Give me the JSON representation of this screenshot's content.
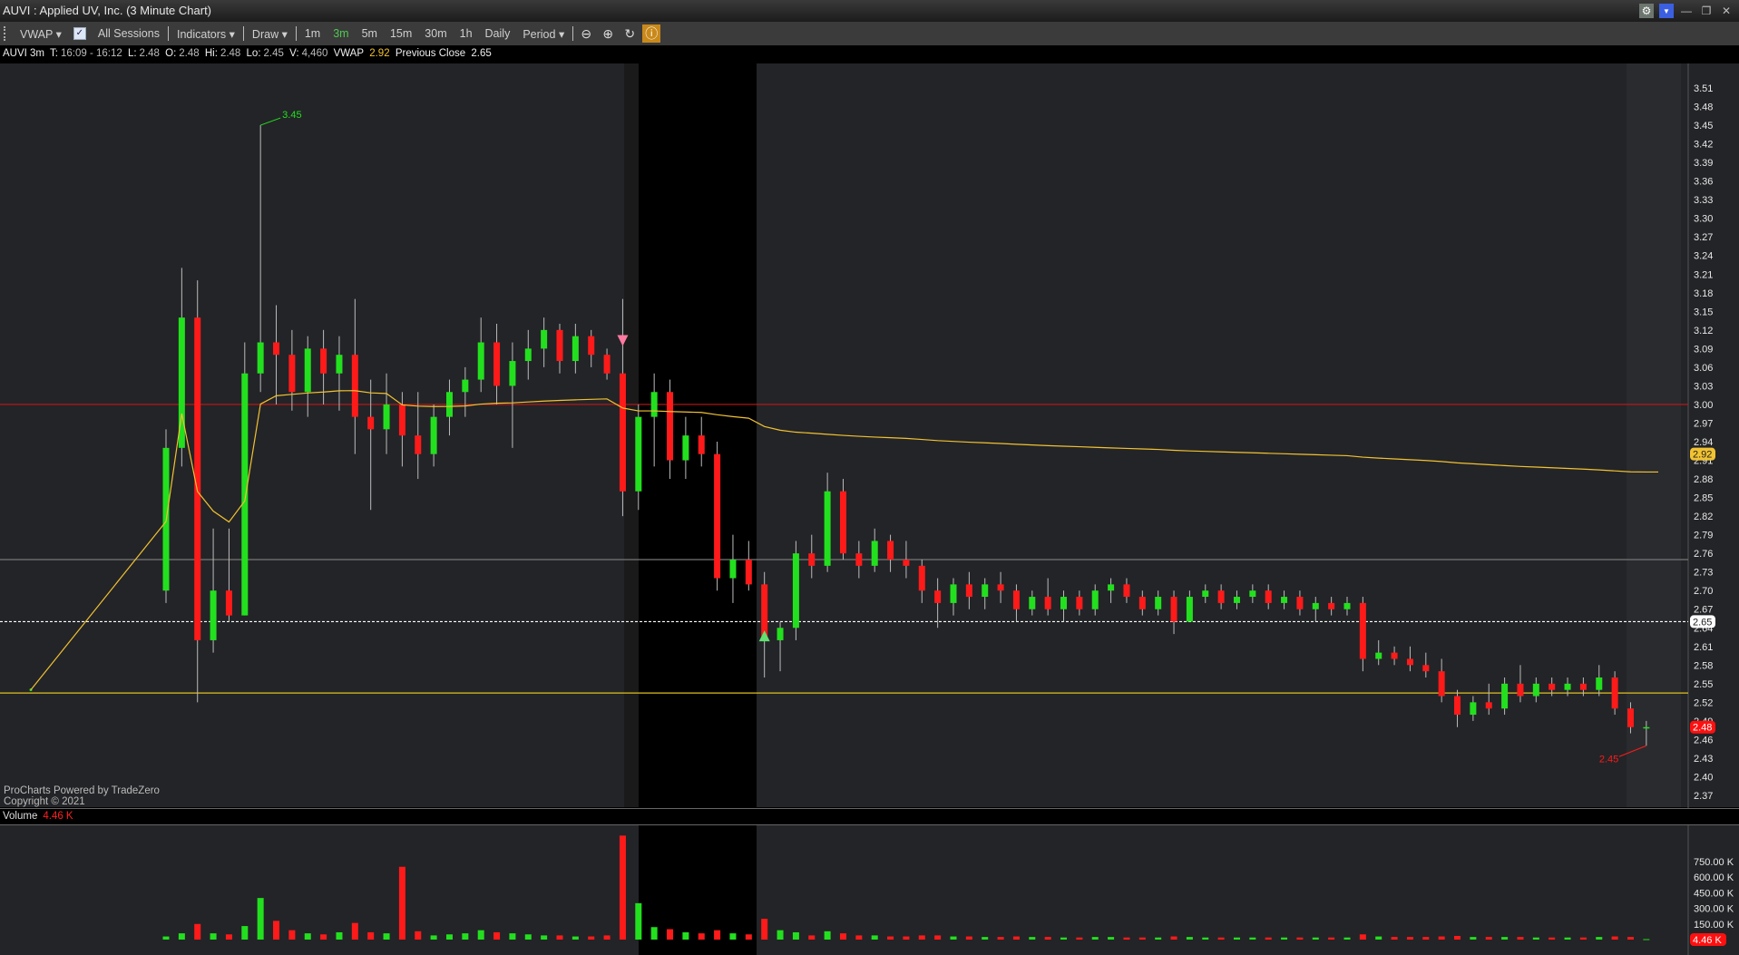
{
  "window": {
    "title": "AUVI : Applied UV, Inc. (3 Minute Chart)"
  },
  "toolbar": {
    "vwap": "VWAP",
    "all_sessions": "All Sessions",
    "indicators": "Indicators",
    "draw": "Draw",
    "intervals": [
      "1m",
      "3m",
      "5m",
      "15m",
      "30m",
      "1h",
      "Daily"
    ],
    "active_interval": "3m",
    "period": "Period"
  },
  "info": {
    "symbol": "AUVI 3m",
    "t_label": "T:",
    "t_value": "16:09 - 16:12",
    "l_label": "L:",
    "l_value": "2.48",
    "o_label": "O:",
    "o_value": "2.48",
    "hi_label": "Hi:",
    "hi_value": "2.48",
    "lo_label": "Lo:",
    "lo_value": "2.45",
    "v_label": "V:",
    "v_value": "4,460",
    "vwap_label": "VWAP",
    "vwap_value": "2.92",
    "prev_label": "Previous Close",
    "prev_value": "2.65"
  },
  "watermark": {
    "line1": "ProCharts Powered by TradeZero",
    "line2": "Copyright © 2021"
  },
  "volume_pane": {
    "label": "Volume",
    "value": "4.46 K"
  },
  "colors": {
    "up": "#22e01e",
    "down": "#ff1a1a",
    "vwap": "#f1c232",
    "bg": "#232427",
    "accent": "#c9891a"
  },
  "chart_data": {
    "type": "candlestick",
    "title": "AUVI : Applied UV, Inc. (3 Minute Chart)",
    "price_ticks": [
      "3.51",
      "3.48",
      "3.45",
      "3.42",
      "3.39",
      "3.36",
      "3.33",
      "3.30",
      "3.27",
      "3.24",
      "3.21",
      "3.18",
      "3.15",
      "3.12",
      "3.09",
      "3.06",
      "3.03",
      "3.00",
      "2.97",
      "2.94",
      "2.91",
      "2.88",
      "2.85",
      "2.82",
      "2.79",
      "2.76",
      "2.73",
      "2.70",
      "2.67",
      "2.64",
      "2.61",
      "2.58",
      "2.55",
      "2.52",
      "2.49",
      "2.46",
      "2.43",
      "2.40",
      "2.37"
    ],
    "ylim": [
      2.37,
      3.51
    ],
    "volume_ticks": [
      "750.00 K",
      "600.00 K",
      "450.00 K",
      "300.00 K",
      "150.00 K"
    ],
    "volume_max_k": 750,
    "premarket_price": 2.54,
    "levels": [
      {
        "price": 3.0,
        "color": "#c01818",
        "style": "solid"
      },
      {
        "price": 2.75,
        "color": "#777777",
        "style": "solid"
      },
      {
        "price": 2.65,
        "color": "#ffffff",
        "style": "dashed"
      },
      {
        "price": 2.535,
        "color": "#e0c020",
        "style": "solid"
      }
    ],
    "axis_badges": [
      {
        "text": "2.92",
        "price": 2.92,
        "bg": "#f1c232",
        "fg": "#222"
      },
      {
        "text": "2.65",
        "price": 2.65,
        "bg": "#ffffff",
        "fg": "#222"
      },
      {
        "text": "2.48",
        "price": 2.48,
        "bg": "#ff1010",
        "fg": "#fff"
      }
    ],
    "high_label": {
      "text": "3.45",
      "index": 6
    },
    "low_label": {
      "text": "2.45",
      "index": 94
    },
    "sell_marker_index": 29,
    "buy_marker_index": 38,
    "candles_ohlcv_k": [
      [
        2.7,
        2.96,
        2.68,
        2.93,
        30
      ],
      [
        2.93,
        3.22,
        2.9,
        3.14,
        60
      ],
      [
        3.14,
        3.2,
        2.52,
        2.62,
        150
      ],
      [
        2.62,
        2.8,
        2.6,
        2.7,
        60
      ],
      [
        2.7,
        2.8,
        2.65,
        2.66,
        50
      ],
      [
        2.66,
        3.1,
        2.66,
        3.05,
        130
      ],
      [
        3.05,
        3.45,
        3.02,
        3.1,
        400
      ],
      [
        3.1,
        3.16,
        3.0,
        3.08,
        180
      ],
      [
        3.08,
        3.12,
        2.99,
        3.02,
        90
      ],
      [
        3.02,
        3.11,
        2.98,
        3.09,
        60
      ],
      [
        3.09,
        3.12,
        3.0,
        3.05,
        50
      ],
      [
        3.05,
        3.11,
        2.99,
        3.08,
        70
      ],
      [
        3.08,
        3.17,
        2.92,
        2.98,
        160
      ],
      [
        2.98,
        3.04,
        2.83,
        2.96,
        70
      ],
      [
        2.96,
        3.05,
        2.92,
        3.0,
        60
      ],
      [
        3.0,
        3.02,
        2.9,
        2.95,
        700
      ],
      [
        2.95,
        3.02,
        2.88,
        2.92,
        80
      ],
      [
        2.92,
        3.0,
        2.9,
        2.98,
        40
      ],
      [
        2.98,
        3.04,
        2.95,
        3.02,
        50
      ],
      [
        3.02,
        3.06,
        2.98,
        3.04,
        60
      ],
      [
        3.04,
        3.14,
        3.02,
        3.1,
        90
      ],
      [
        3.1,
        3.13,
        3.0,
        3.03,
        70
      ],
      [
        3.03,
        3.1,
        2.93,
        3.07,
        60
      ],
      [
        3.07,
        3.12,
        3.04,
        3.09,
        50
      ],
      [
        3.09,
        3.14,
        3.06,
        3.12,
        40
      ],
      [
        3.12,
        3.13,
        3.05,
        3.07,
        40
      ],
      [
        3.07,
        3.13,
        3.05,
        3.11,
        30
      ],
      [
        3.11,
        3.12,
        3.06,
        3.08,
        30
      ],
      [
        3.08,
        3.09,
        3.04,
        3.05,
        40
      ],
      [
        3.05,
        3.17,
        2.82,
        2.86,
        1000
      ],
      [
        2.86,
        3.0,
        2.83,
        2.98,
        350
      ],
      [
        2.98,
        3.05,
        2.9,
        3.02,
        120
      ],
      [
        3.02,
        3.04,
        2.88,
        2.91,
        100
      ],
      [
        2.91,
        2.98,
        2.88,
        2.95,
        70
      ],
      [
        2.95,
        2.98,
        2.9,
        2.92,
        60
      ],
      [
        2.92,
        2.94,
        2.7,
        2.72,
        90
      ],
      [
        2.72,
        2.79,
        2.68,
        2.75,
        60
      ],
      [
        2.75,
        2.78,
        2.7,
        2.71,
        50
      ],
      [
        2.71,
        2.73,
        2.56,
        2.62,
        200
      ],
      [
        2.62,
        2.65,
        2.57,
        2.64,
        90
      ],
      [
        2.64,
        2.78,
        2.62,
        2.76,
        70
      ],
      [
        2.76,
        2.79,
        2.72,
        2.74,
        40
      ],
      [
        2.74,
        2.89,
        2.73,
        2.86,
        80
      ],
      [
        2.86,
        2.88,
        2.75,
        2.76,
        60
      ],
      [
        2.76,
        2.78,
        2.72,
        2.74,
        40
      ],
      [
        2.74,
        2.8,
        2.73,
        2.78,
        40
      ],
      [
        2.78,
        2.79,
        2.73,
        2.75,
        30
      ],
      [
        2.75,
        2.78,
        2.72,
        2.74,
        30
      ],
      [
        2.74,
        2.75,
        2.68,
        2.7,
        40
      ],
      [
        2.7,
        2.72,
        2.64,
        2.68,
        40
      ],
      [
        2.68,
        2.72,
        2.66,
        2.71,
        30
      ],
      [
        2.71,
        2.73,
        2.67,
        2.69,
        30
      ],
      [
        2.69,
        2.72,
        2.67,
        2.71,
        25
      ],
      [
        2.71,
        2.73,
        2.68,
        2.7,
        25
      ],
      [
        2.7,
        2.71,
        2.65,
        2.67,
        30
      ],
      [
        2.67,
        2.7,
        2.66,
        2.69,
        25
      ],
      [
        2.69,
        2.72,
        2.66,
        2.67,
        25
      ],
      [
        2.67,
        2.7,
        2.65,
        2.69,
        20
      ],
      [
        2.69,
        2.7,
        2.66,
        2.67,
        20
      ],
      [
        2.67,
        2.71,
        2.66,
        2.7,
        25
      ],
      [
        2.7,
        2.72,
        2.68,
        2.71,
        25
      ],
      [
        2.71,
        2.72,
        2.68,
        2.69,
        20
      ],
      [
        2.69,
        2.7,
        2.66,
        2.67,
        20
      ],
      [
        2.67,
        2.7,
        2.66,
        2.69,
        20
      ],
      [
        2.69,
        2.7,
        2.63,
        2.65,
        30
      ],
      [
        2.65,
        2.7,
        2.65,
        2.69,
        25
      ],
      [
        2.69,
        2.71,
        2.68,
        2.7,
        20
      ],
      [
        2.7,
        2.71,
        2.67,
        2.68,
        20
      ],
      [
        2.68,
        2.7,
        2.67,
        2.69,
        20
      ],
      [
        2.69,
        2.71,
        2.68,
        2.7,
        20
      ],
      [
        2.7,
        2.71,
        2.67,
        2.68,
        20
      ],
      [
        2.68,
        2.7,
        2.67,
        2.69,
        20
      ],
      [
        2.69,
        2.7,
        2.66,
        2.67,
        20
      ],
      [
        2.67,
        2.69,
        2.65,
        2.68,
        20
      ],
      [
        2.68,
        2.69,
        2.66,
        2.67,
        20
      ],
      [
        2.67,
        2.69,
        2.66,
        2.68,
        20
      ],
      [
        2.68,
        2.69,
        2.57,
        2.59,
        50
      ],
      [
        2.59,
        2.62,
        2.58,
        2.6,
        30
      ],
      [
        2.6,
        2.61,
        2.58,
        2.59,
        25
      ],
      [
        2.59,
        2.61,
        2.57,
        2.58,
        25
      ],
      [
        2.58,
        2.6,
        2.56,
        2.57,
        25
      ],
      [
        2.57,
        2.59,
        2.52,
        2.53,
        30
      ],
      [
        2.53,
        2.54,
        2.48,
        2.5,
        35
      ],
      [
        2.5,
        2.53,
        2.49,
        2.52,
        25
      ],
      [
        2.52,
        2.55,
        2.5,
        2.51,
        25
      ],
      [
        2.51,
        2.56,
        2.5,
        2.55,
        25
      ],
      [
        2.55,
        2.58,
        2.52,
        2.53,
        25
      ],
      [
        2.53,
        2.56,
        2.52,
        2.55,
        20
      ],
      [
        2.55,
        2.56,
        2.53,
        2.54,
        20
      ],
      [
        2.54,
        2.56,
        2.53,
        2.55,
        20
      ],
      [
        2.55,
        2.56,
        2.53,
        2.54,
        20
      ],
      [
        2.54,
        2.58,
        2.53,
        2.56,
        25
      ],
      [
        2.56,
        2.57,
        2.5,
        2.51,
        30
      ],
      [
        2.51,
        2.52,
        2.47,
        2.48,
        25
      ],
      [
        2.48,
        2.49,
        2.45,
        2.48,
        4.46
      ]
    ]
  }
}
